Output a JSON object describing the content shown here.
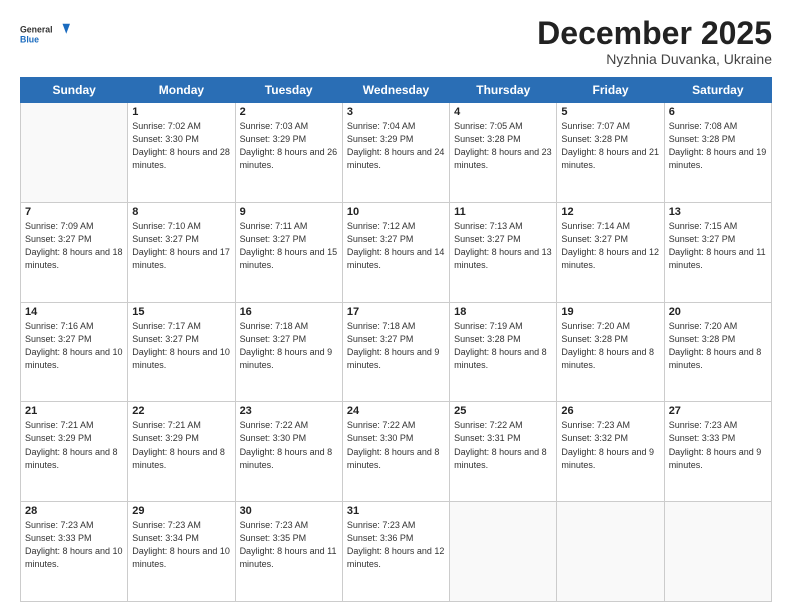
{
  "logo": {
    "line1": "General",
    "line2": "Blue"
  },
  "header": {
    "month": "December 2025",
    "location": "Nyzhnia Duvanka, Ukraine"
  },
  "weekdays": [
    "Sunday",
    "Monday",
    "Tuesday",
    "Wednesday",
    "Thursday",
    "Friday",
    "Saturday"
  ],
  "weeks": [
    [
      {
        "day": "",
        "sunrise": "",
        "sunset": "",
        "daylight": ""
      },
      {
        "day": "1",
        "sunrise": "Sunrise: 7:02 AM",
        "sunset": "Sunset: 3:30 PM",
        "daylight": "Daylight: 8 hours and 28 minutes."
      },
      {
        "day": "2",
        "sunrise": "Sunrise: 7:03 AM",
        "sunset": "Sunset: 3:29 PM",
        "daylight": "Daylight: 8 hours and 26 minutes."
      },
      {
        "day": "3",
        "sunrise": "Sunrise: 7:04 AM",
        "sunset": "Sunset: 3:29 PM",
        "daylight": "Daylight: 8 hours and 24 minutes."
      },
      {
        "day": "4",
        "sunrise": "Sunrise: 7:05 AM",
        "sunset": "Sunset: 3:28 PM",
        "daylight": "Daylight: 8 hours and 23 minutes."
      },
      {
        "day": "5",
        "sunrise": "Sunrise: 7:07 AM",
        "sunset": "Sunset: 3:28 PM",
        "daylight": "Daylight: 8 hours and 21 minutes."
      },
      {
        "day": "6",
        "sunrise": "Sunrise: 7:08 AM",
        "sunset": "Sunset: 3:28 PM",
        "daylight": "Daylight: 8 hours and 19 minutes."
      }
    ],
    [
      {
        "day": "7",
        "sunrise": "Sunrise: 7:09 AM",
        "sunset": "Sunset: 3:27 PM",
        "daylight": "Daylight: 8 hours and 18 minutes."
      },
      {
        "day": "8",
        "sunrise": "Sunrise: 7:10 AM",
        "sunset": "Sunset: 3:27 PM",
        "daylight": "Daylight: 8 hours and 17 minutes."
      },
      {
        "day": "9",
        "sunrise": "Sunrise: 7:11 AM",
        "sunset": "Sunset: 3:27 PM",
        "daylight": "Daylight: 8 hours and 15 minutes."
      },
      {
        "day": "10",
        "sunrise": "Sunrise: 7:12 AM",
        "sunset": "Sunset: 3:27 PM",
        "daylight": "Daylight: 8 hours and 14 minutes."
      },
      {
        "day": "11",
        "sunrise": "Sunrise: 7:13 AM",
        "sunset": "Sunset: 3:27 PM",
        "daylight": "Daylight: 8 hours and 13 minutes."
      },
      {
        "day": "12",
        "sunrise": "Sunrise: 7:14 AM",
        "sunset": "Sunset: 3:27 PM",
        "daylight": "Daylight: 8 hours and 12 minutes."
      },
      {
        "day": "13",
        "sunrise": "Sunrise: 7:15 AM",
        "sunset": "Sunset: 3:27 PM",
        "daylight": "Daylight: 8 hours and 11 minutes."
      }
    ],
    [
      {
        "day": "14",
        "sunrise": "Sunrise: 7:16 AM",
        "sunset": "Sunset: 3:27 PM",
        "daylight": "Daylight: 8 hours and 10 minutes."
      },
      {
        "day": "15",
        "sunrise": "Sunrise: 7:17 AM",
        "sunset": "Sunset: 3:27 PM",
        "daylight": "Daylight: 8 hours and 10 minutes."
      },
      {
        "day": "16",
        "sunrise": "Sunrise: 7:18 AM",
        "sunset": "Sunset: 3:27 PM",
        "daylight": "Daylight: 8 hours and 9 minutes."
      },
      {
        "day": "17",
        "sunrise": "Sunrise: 7:18 AM",
        "sunset": "Sunset: 3:27 PM",
        "daylight": "Daylight: 8 hours and 9 minutes."
      },
      {
        "day": "18",
        "sunrise": "Sunrise: 7:19 AM",
        "sunset": "Sunset: 3:28 PM",
        "daylight": "Daylight: 8 hours and 8 minutes."
      },
      {
        "day": "19",
        "sunrise": "Sunrise: 7:20 AM",
        "sunset": "Sunset: 3:28 PM",
        "daylight": "Daylight: 8 hours and 8 minutes."
      },
      {
        "day": "20",
        "sunrise": "Sunrise: 7:20 AM",
        "sunset": "Sunset: 3:28 PM",
        "daylight": "Daylight: 8 hours and 8 minutes."
      }
    ],
    [
      {
        "day": "21",
        "sunrise": "Sunrise: 7:21 AM",
        "sunset": "Sunset: 3:29 PM",
        "daylight": "Daylight: 8 hours and 8 minutes."
      },
      {
        "day": "22",
        "sunrise": "Sunrise: 7:21 AM",
        "sunset": "Sunset: 3:29 PM",
        "daylight": "Daylight: 8 hours and 8 minutes."
      },
      {
        "day": "23",
        "sunrise": "Sunrise: 7:22 AM",
        "sunset": "Sunset: 3:30 PM",
        "daylight": "Daylight: 8 hours and 8 minutes."
      },
      {
        "day": "24",
        "sunrise": "Sunrise: 7:22 AM",
        "sunset": "Sunset: 3:30 PM",
        "daylight": "Daylight: 8 hours and 8 minutes."
      },
      {
        "day": "25",
        "sunrise": "Sunrise: 7:22 AM",
        "sunset": "Sunset: 3:31 PM",
        "daylight": "Daylight: 8 hours and 8 minutes."
      },
      {
        "day": "26",
        "sunrise": "Sunrise: 7:23 AM",
        "sunset": "Sunset: 3:32 PM",
        "daylight": "Daylight: 8 hours and 9 minutes."
      },
      {
        "day": "27",
        "sunrise": "Sunrise: 7:23 AM",
        "sunset": "Sunset: 3:33 PM",
        "daylight": "Daylight: 8 hours and 9 minutes."
      }
    ],
    [
      {
        "day": "28",
        "sunrise": "Sunrise: 7:23 AM",
        "sunset": "Sunset: 3:33 PM",
        "daylight": "Daylight: 8 hours and 10 minutes."
      },
      {
        "day": "29",
        "sunrise": "Sunrise: 7:23 AM",
        "sunset": "Sunset: 3:34 PM",
        "daylight": "Daylight: 8 hours and 10 minutes."
      },
      {
        "day": "30",
        "sunrise": "Sunrise: 7:23 AM",
        "sunset": "Sunset: 3:35 PM",
        "daylight": "Daylight: 8 hours and 11 minutes."
      },
      {
        "day": "31",
        "sunrise": "Sunrise: 7:23 AM",
        "sunset": "Sunset: 3:36 PM",
        "daylight": "Daylight: 8 hours and 12 minutes."
      },
      {
        "day": "",
        "sunrise": "",
        "sunset": "",
        "daylight": ""
      },
      {
        "day": "",
        "sunrise": "",
        "sunset": "",
        "daylight": ""
      },
      {
        "day": "",
        "sunrise": "",
        "sunset": "",
        "daylight": ""
      }
    ]
  ]
}
